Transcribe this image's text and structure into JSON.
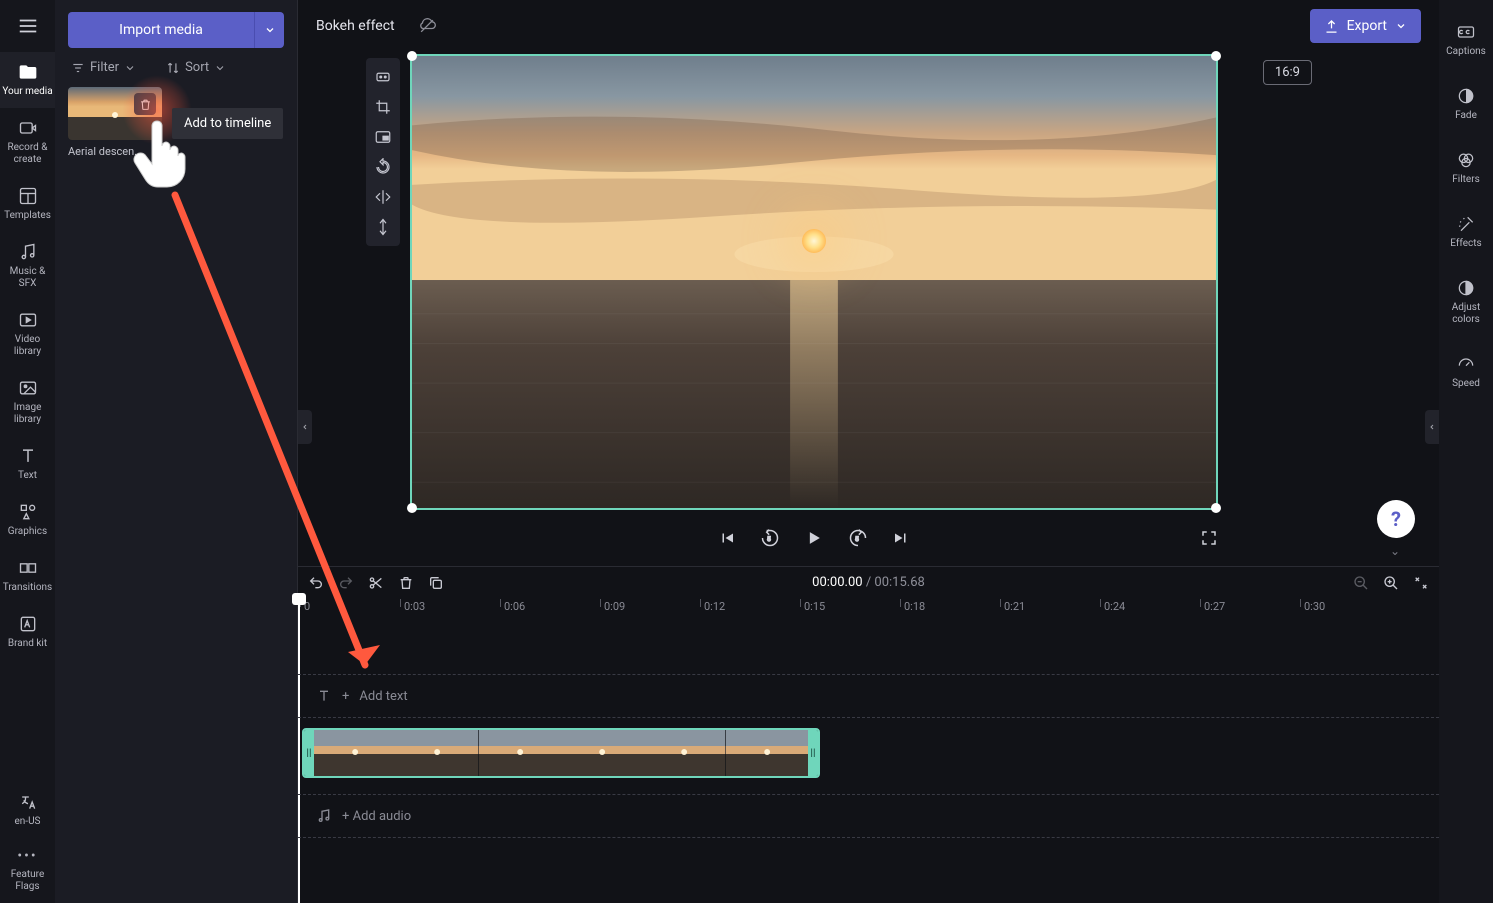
{
  "header": {
    "title": "Bokeh effect",
    "export_label": "Export",
    "aspect_ratio": "16:9"
  },
  "import": {
    "label": "Import media",
    "filter_label": "Filter",
    "sort_label": "Sort"
  },
  "media": {
    "thumb_label": "Aerial descen..."
  },
  "tooltip": {
    "add_to_timeline": "Add to timeline"
  },
  "leftnav": [
    {
      "id": "your-media",
      "label": "Your media"
    },
    {
      "id": "record",
      "label": "Record & create"
    },
    {
      "id": "templates",
      "label": "Templates"
    },
    {
      "id": "music",
      "label": "Music & SFX"
    },
    {
      "id": "video-library",
      "label": "Video library"
    },
    {
      "id": "image-library",
      "label": "Image library"
    },
    {
      "id": "text",
      "label": "Text"
    },
    {
      "id": "graphics",
      "label": "Graphics"
    },
    {
      "id": "transitions",
      "label": "Transitions"
    },
    {
      "id": "brand-kit",
      "label": "Brand kit"
    }
  ],
  "leftnav_bottom": [
    {
      "id": "locale",
      "label": "en-US"
    },
    {
      "id": "flags",
      "label": "Feature Flags"
    }
  ],
  "rightnav": [
    {
      "id": "captions",
      "label": "Captions"
    },
    {
      "id": "fade",
      "label": "Fade"
    },
    {
      "id": "filters",
      "label": "Filters"
    },
    {
      "id": "effects",
      "label": "Effects"
    },
    {
      "id": "adjust",
      "label": "Adjust colors"
    },
    {
      "id": "speed",
      "label": "Speed"
    }
  ],
  "timeline": {
    "current": "00:00.00",
    "total": "00:15.68",
    "ticks": [
      "0",
      "0:03",
      "0:06",
      "0:09",
      "0:12",
      "0:15",
      "0:18",
      "0:21",
      "0:24",
      "0:27",
      "0:30"
    ],
    "text_track_label": "Add text",
    "audio_track_label": "+ Add audio"
  },
  "help": {
    "label": "?"
  }
}
